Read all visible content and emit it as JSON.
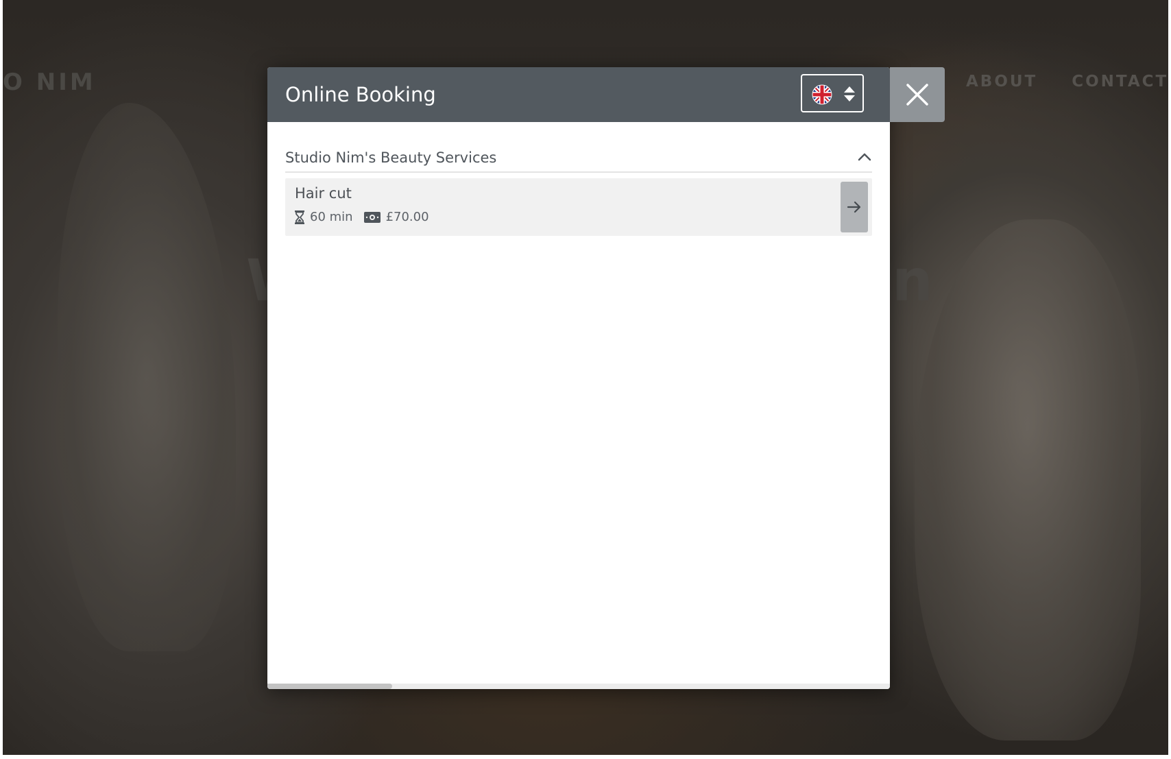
{
  "background": {
    "logo_text": "O NIM",
    "nav": [
      "ABOUT",
      "CONTACT"
    ],
    "hero_left": "W",
    "hero_right": "n"
  },
  "modal": {
    "title": "Online Booking",
    "language": {
      "icon": "uk-flag-icon",
      "toggle_icon": "sort-icon"
    },
    "close_icon": "close-icon",
    "category": {
      "title": "Studio Nim's Beauty Services",
      "toggle_icon": "chevron-up-icon",
      "services": [
        {
          "name": "Hair cut",
          "duration": "60 min",
          "price": "£70.00",
          "duration_icon": "hourglass-icon",
          "price_icon": "money-icon",
          "action_icon": "arrow-right-icon"
        }
      ]
    },
    "scroll_position": 0.0
  },
  "colors": {
    "header": "#535a60",
    "close_button": "#8f9498",
    "service_bg": "#f1f1f1",
    "arrow_button": "#b1b4b7"
  }
}
